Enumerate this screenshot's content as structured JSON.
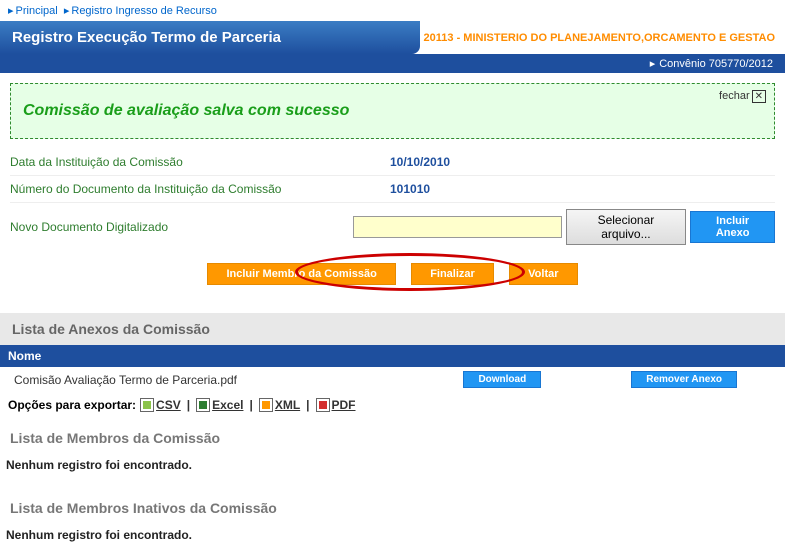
{
  "breadcrumb": {
    "principal": "Principal",
    "registro": "Registro Ingresso de Recurso"
  },
  "header": {
    "title": "Registro Execução Termo de Parceria",
    "ministry": "20113 - MINISTERIO DO PLANEJAMENTO,ORCAMENTO E GESTAO",
    "convenio": "Convênio 705770/2012"
  },
  "success": {
    "message": "Comissão de avaliação salva com sucesso",
    "close": "fechar"
  },
  "form": {
    "data_label": "Data da Instituição da Comissão",
    "data_value": "10/10/2010",
    "numero_label": "Número do Documento da Instituição da Comissão",
    "numero_value": "101010",
    "novo_label": "Novo Documento Digitalizado",
    "selecionar": "Selecionar arquivo...",
    "incluir_anexo": "Incluir Anexo"
  },
  "actions": {
    "incluir_membro": "Incluir Membro da Comissão",
    "finalizar": "Finalizar",
    "voltar": "Voltar"
  },
  "anexos": {
    "title": "Lista de Anexos da Comissão",
    "col_nome": "Nome",
    "row_file": "Comisão Avaliação Termo de Parceria.pdf",
    "download": "Download",
    "remover": "Remover Anexo"
  },
  "export": {
    "label": "Opções para exportar:",
    "csv": "CSV",
    "excel": "Excel",
    "xml": "XML",
    "pdf": "PDF"
  },
  "membros": {
    "title": "Lista de Membros da Comissão",
    "empty": "Nenhum registro foi encontrado."
  },
  "inativos": {
    "title": "Lista de Membros Inativos da Comissão",
    "empty": "Nenhum registro foi encontrado."
  }
}
